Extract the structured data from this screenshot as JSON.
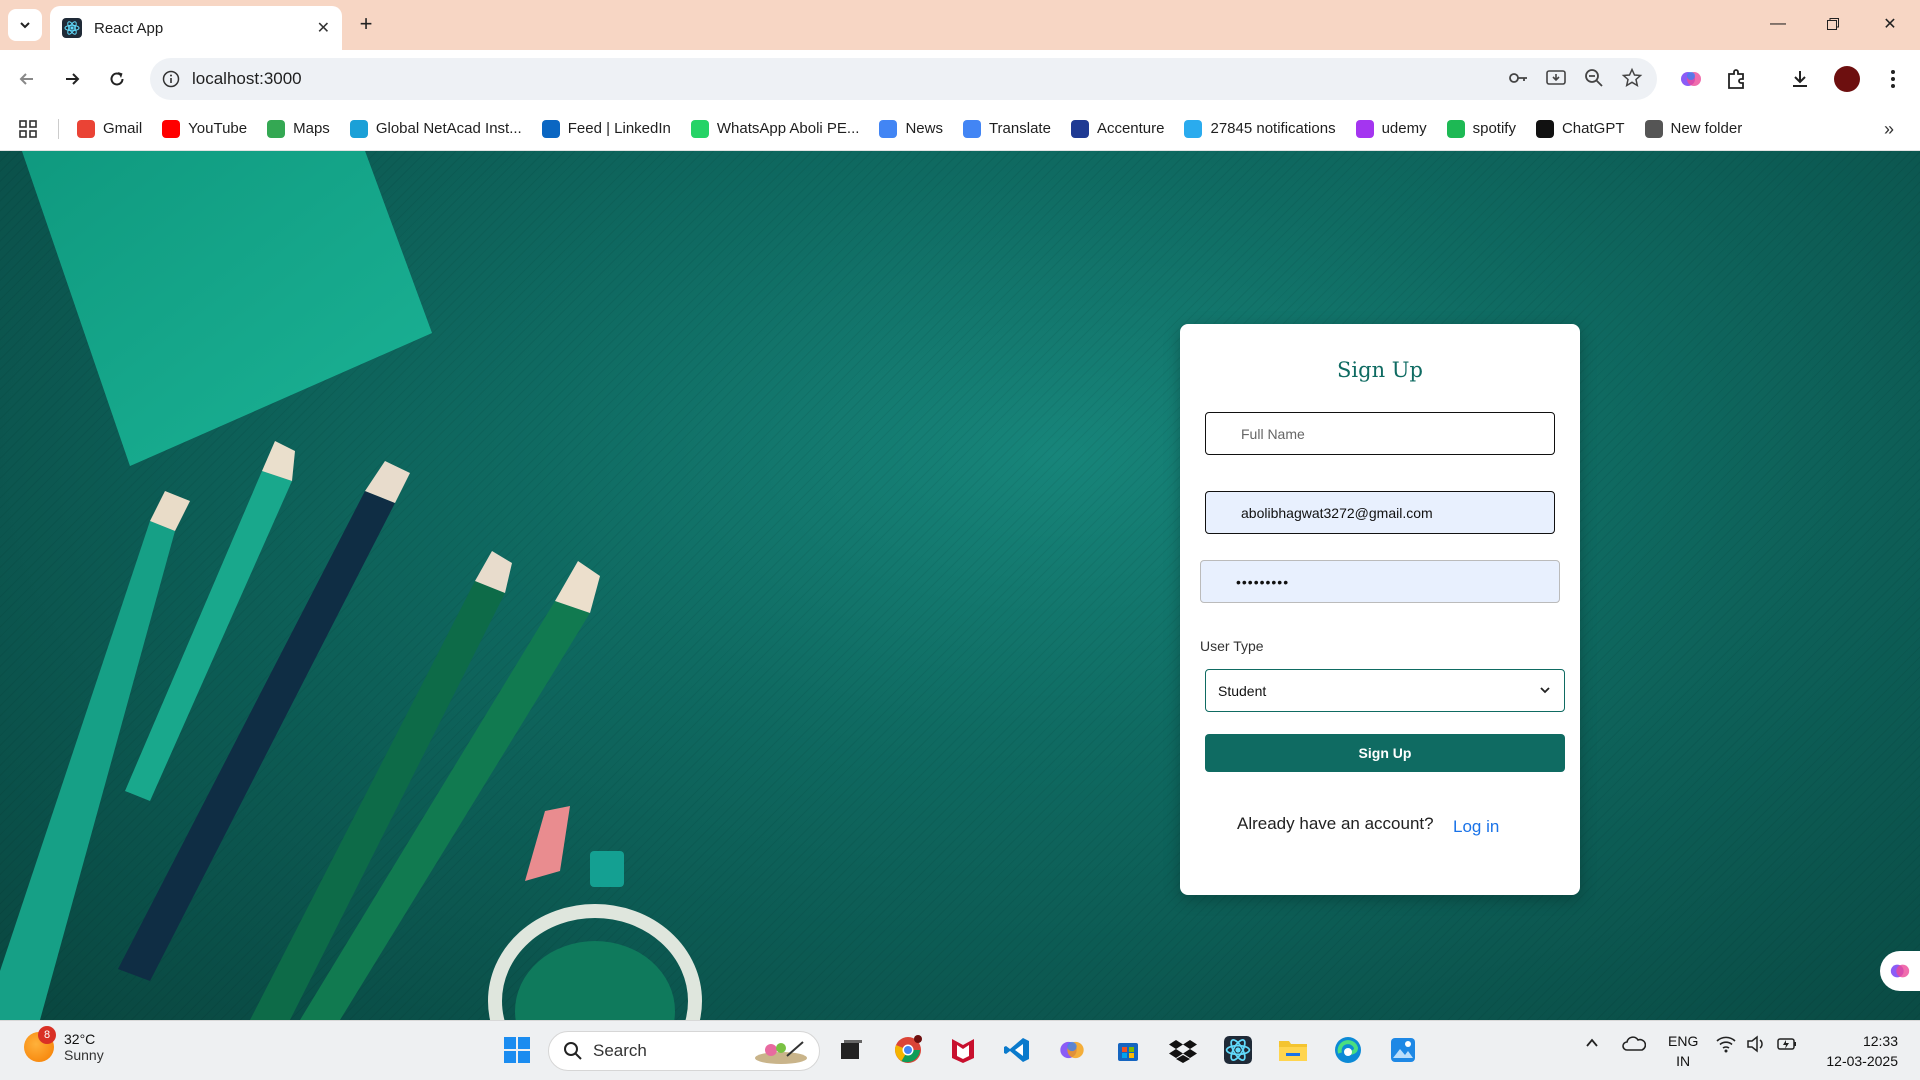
{
  "browser": {
    "tab_title": "React App",
    "url": "localhost:3000",
    "bookmarks": [
      {
        "label": "Gmail",
        "icon": "gmail-icon",
        "color": "#ea4335"
      },
      {
        "label": "YouTube",
        "icon": "youtube-icon",
        "color": "#ff0000"
      },
      {
        "label": "Maps",
        "icon": "maps-icon",
        "color": "#34a853"
      },
      {
        "label": "Global NetAcad Inst...",
        "icon": "cisco-icon",
        "color": "#1ba0d7"
      },
      {
        "label": "Feed | LinkedIn",
        "icon": "linkedin-icon",
        "color": "#0a66c2"
      },
      {
        "label": "WhatsApp Aboli PE...",
        "icon": "whatsapp-icon",
        "color": "#25d366"
      },
      {
        "label": "News",
        "icon": "news-icon",
        "color": "#4285f4"
      },
      {
        "label": "Translate",
        "icon": "translate-icon",
        "color": "#4285f4"
      },
      {
        "label": "Accenture",
        "icon": "accenture-icon",
        "color": "#1f3a93"
      },
      {
        "label": "27845 notifications",
        "icon": "telegram-icon",
        "color": "#2aabee"
      },
      {
        "label": "udemy",
        "icon": "udemy-icon",
        "color": "#a435f0"
      },
      {
        "label": "spotify",
        "icon": "spotify-icon",
        "color": "#1db954"
      },
      {
        "label": "ChatGPT",
        "icon": "chatgpt-icon",
        "color": "#111111"
      },
      {
        "label": "New folder",
        "icon": "folder-icon",
        "color": "#555555"
      }
    ]
  },
  "signup": {
    "title": "Sign Up",
    "full_name_placeholder": "Full Name",
    "email_value": "abolibhagwat3272@gmail.com",
    "password_masked": "•••••••••",
    "user_type_label": "User Type",
    "user_type_value": "Student",
    "submit_label": "Sign Up",
    "already_text": "Already have an account?",
    "login_link": "Log in"
  },
  "taskbar": {
    "weather_badge": "8",
    "temperature": "32°C",
    "condition": "Sunny",
    "search_label": "Search",
    "lang_line1": "ENG",
    "lang_line2": "IN",
    "time": "12:33",
    "date": "12-03-2025"
  },
  "colors": {
    "accent": "#0f6b62",
    "link": "#1a73e8",
    "titlebar": "#f7d6c4"
  }
}
